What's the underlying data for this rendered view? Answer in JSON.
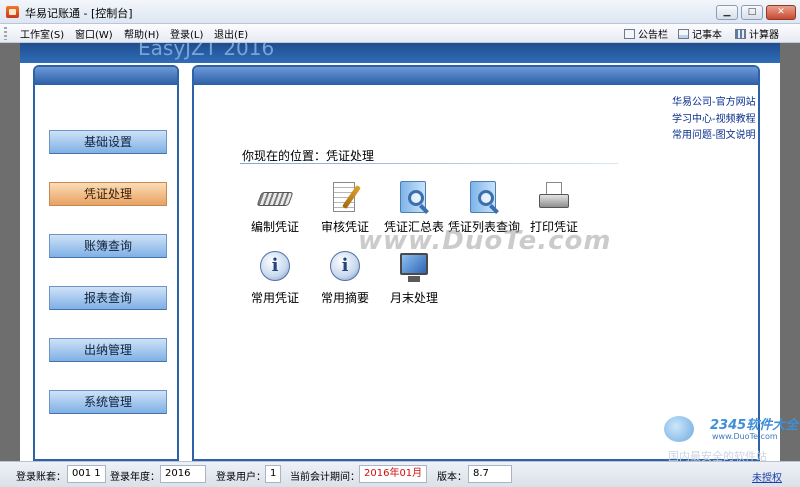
{
  "window": {
    "title": "华易记账通 - [控制台]",
    "min_glyph": "▁",
    "max_glyph": "□",
    "close_glyph": "✕"
  },
  "menu": {
    "items": [
      "工作室(S)",
      "窗口(W)",
      "帮助(H)",
      "登录(L)",
      "退出(E)"
    ],
    "tools": [
      "公告栏",
      "记事本",
      "计算器"
    ]
  },
  "banner": {
    "text": "EasyJZT 2016"
  },
  "sidebar": {
    "items": [
      {
        "label": "基础设置",
        "active": false
      },
      {
        "label": "凭证处理",
        "active": true
      },
      {
        "label": "账簿查询",
        "active": false
      },
      {
        "label": "报表查询",
        "active": false
      },
      {
        "label": "出纳管理",
        "active": false
      },
      {
        "label": "系统管理",
        "active": false
      }
    ]
  },
  "links": [
    "华易公司-官方网站",
    "学习中心-视频教程",
    "常用问题-图文说明"
  ],
  "location": "你现在的位置：凭证处理",
  "functions": [
    {
      "label": "编制凭证",
      "icon": "keyboard-icon"
    },
    {
      "label": "审核凭证",
      "icon": "document-pen-icon"
    },
    {
      "label": "凭证汇总表",
      "icon": "book-search-icon"
    },
    {
      "label": "凭证列表查询",
      "icon": "book-search-icon"
    },
    {
      "label": "打印凭证",
      "icon": "printer-icon"
    },
    {
      "label": "常用凭证",
      "icon": "info-icon"
    },
    {
      "label": "常用摘要",
      "icon": "info-icon"
    },
    {
      "label": "月末处理",
      "icon": "monitor-icon"
    }
  ],
  "info_glyph": "i",
  "watermark": {
    "duote": "www.DuoTe.com",
    "logo": "2345软件大全",
    "url": "www.DuoTe.com",
    "slogan": "国内最安全的软件站"
  },
  "status": {
    "account_label": "登录账套：",
    "account_value": "001 1",
    "year_label": "登录年度：",
    "year_value": "2016",
    "user_label": "登录用户：",
    "user_value": "1",
    "period_label": "当前会计期间：",
    "period_value": "2016年01月",
    "version_label": "版本：",
    "version_value": "8.7",
    "license": "未授权"
  },
  "colors": {
    "accent_blue": "#2e62a8",
    "active_orange": "#e8a263",
    "period_red": "#d01010"
  }
}
